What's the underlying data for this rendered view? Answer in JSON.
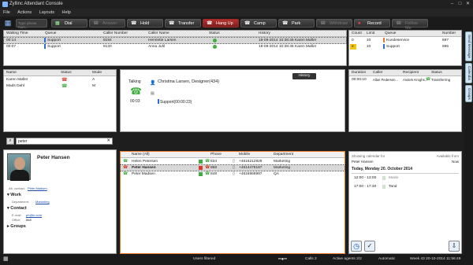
{
  "app": {
    "title": "Zyllinc Attendant Console"
  },
  "menu": [
    "File",
    "Actions",
    "Layouts",
    "Help"
  ],
  "toolbar": {
    "phone_placeholder": "Type phone num...",
    "buttons": [
      {
        "label": "Dial",
        "icon": "dial-icon",
        "state": "enabled"
      },
      {
        "label": "Answer",
        "icon": "answer-icon",
        "state": "disabled"
      },
      {
        "label": "Hold",
        "icon": "hold-icon",
        "state": "enabled"
      },
      {
        "label": "Transfer",
        "icon": "transfer-icon",
        "state": "enabled"
      },
      {
        "label": "Hang Up",
        "icon": "hangup-icon",
        "state": "red"
      },
      {
        "label": "Camp",
        "icon": "camp-icon",
        "state": "enabled"
      },
      {
        "label": "Park",
        "icon": "park-icon",
        "state": "enabled"
      },
      {
        "label": "Withdraw",
        "icon": "withdraw-icon",
        "state": "disabled"
      },
      {
        "label": "Record",
        "icon": "record-icon",
        "state": "enabled"
      },
      {
        "label": "Follow Me",
        "icon": "follow-me-icon",
        "state": "disabled"
      }
    ]
  },
  "waiting": {
    "headers": [
      "Waiting Time",
      "Queue",
      "Caller Number",
      "Caller Name",
      "Status",
      "History"
    ],
    "rows": [
      {
        "time": "00:14",
        "queue": "Support",
        "number": "8194",
        "name": "Henriette Larsen",
        "status": "green",
        "history": "19-09-2014 10:38:46 Karen Møller"
      },
      {
        "time": "00:07",
        "queue": "Support",
        "number": "8120",
        "name": "Anna Juhl",
        "status": "green",
        "history": "19-09-2014 10:38:46 Karen Møller"
      }
    ]
  },
  "queues": {
    "headers": [
      "Count",
      "Limit",
      "Queue",
      "Number"
    ],
    "rows": [
      {
        "count": "0",
        "limit": "10",
        "queue": "Kundeservice",
        "number": "697",
        "color": "#e87a2b",
        "count_bg": "#ffffff"
      },
      {
        "count": "2",
        "limit": "10",
        "queue": "Support",
        "number": "696",
        "color": "#2b6fd3",
        "count_bg": "#f1c40f"
      }
    ]
  },
  "agents": {
    "headers": [
      "Name",
      "Status",
      "Mode"
    ],
    "rows": [
      {
        "name": "Karen Møller",
        "mode": "A"
      },
      {
        "name": "Mads Dahl",
        "mode": "M"
      }
    ]
  },
  "call": {
    "state": "Talking",
    "timer": "00:03",
    "person": "Christina Larsen, Designer(434)",
    "queue": "Support(00:00:23)",
    "history_button": "History"
  },
  "transfers": {
    "headers": [
      "Duration",
      "Caller",
      "Recipient",
      "Status"
    ],
    "rows": [
      {
        "duration": "00:00:10",
        "caller": "Allan Pedersen...",
        "recipient": "Anders Kroghs...",
        "status": "Transferring"
      }
    ]
  },
  "search": {
    "value": "peter"
  },
  "contact": {
    "name": "Peter Hansen",
    "alt_contact_label": "Alt. contact:",
    "alt_contact": "Peter.Madsen",
    "work_title": "Work",
    "department_label": "Department:",
    "department": "Marketing",
    "contact_title": "Contact",
    "email_label": "E-mail:",
    "email": "ph@ic.com",
    "office_label": "Office:",
    "office": "868",
    "groups_title": "Groups"
  },
  "directory": {
    "headers": [
      "Name (All)",
      "Phone",
      "Mobile",
      "Department"
    ],
    "rows": [
      {
        "name": "Helen Petersen",
        "phone": "834",
        "mobile": "+4616212928",
        "department": "Marketing",
        "status": "green"
      },
      {
        "name": "Peter Hansen",
        "phone": "868",
        "mobile": "+4614476187",
        "department": "Marketing",
        "status": "red"
      },
      {
        "name": "Peter Madsen",
        "phone": "848",
        "mobile": "+4616968997",
        "department": "QA",
        "status": "green"
      }
    ]
  },
  "calendar": {
    "showing_label": "Showing calendar for",
    "showing_name": "Peter Hansen",
    "available_label": "Available from",
    "available_value": "Now",
    "date": "Today, Monday 20. October 2014",
    "entries": [
      {
        "time": "12:00 - 13:00",
        "text": "Møde"
      },
      {
        "time": "17:00 - 17:30",
        "text": "Tand"
      }
    ]
  },
  "sidetabs": [
    "Send Message",
    "Calendar",
    "Groups"
  ],
  "status": {
    "users_filtered": "Users filtered",
    "calls": "Calls 2",
    "agents": "Active agents 2/2",
    "mode": "Automatic",
    "date": "Week 43  20-10-2014  11:56:49"
  }
}
